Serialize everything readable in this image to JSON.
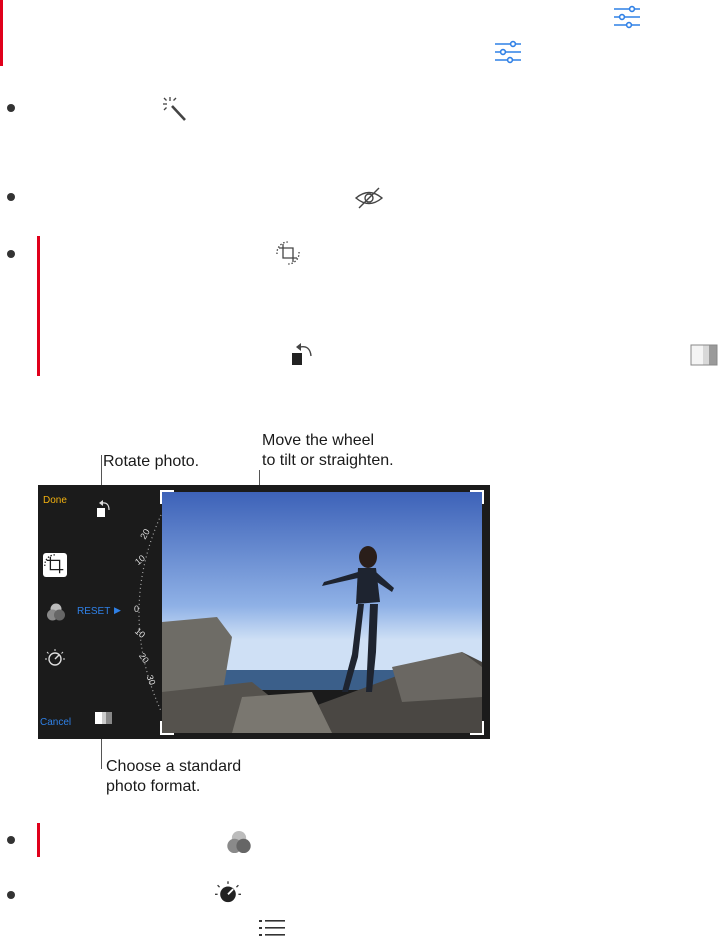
{
  "editor": {
    "done_label": "Done",
    "cancel_label": "Cancel",
    "reset_label": "RESET",
    "reset_arrow": "▶",
    "wheel_ticks": [
      "20",
      "10",
      "0",
      "10",
      "20",
      "30"
    ]
  },
  "annotations": {
    "rotate": "Rotate photo.",
    "wheel_line1": "Move the wheel",
    "wheel_line2": "to tilt or straighten.",
    "format_line1": "Choose a standard",
    "format_line2": "photo format."
  },
  "icons": {
    "adjust": "sliders-icon",
    "enhance": "magic-wand-icon",
    "redeye": "red-eye-icon",
    "crop": "crop-rotate-icon",
    "rotate": "rotate-left-icon",
    "aspect": "aspect-ratio-icon",
    "filters": "filters-icon",
    "light": "light-dial-icon",
    "list": "list-icon"
  },
  "colors": {
    "accent_blue": "#2f80e6",
    "editor_yellow": "#f2b10f",
    "red_bar": "#e0001b"
  }
}
